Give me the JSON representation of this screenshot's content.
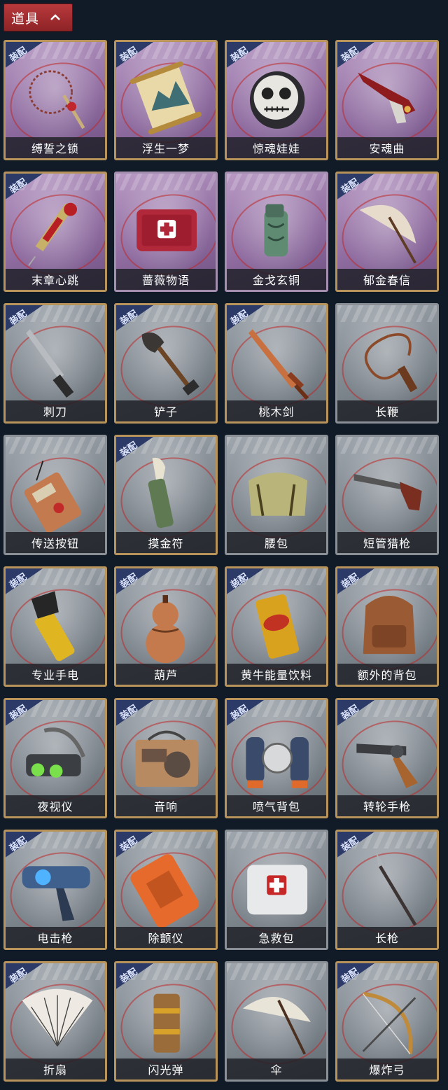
{
  "header": {
    "title": "道具"
  },
  "equip_badge": "装配",
  "items": [
    {
      "name": "缚誓之锁",
      "equipped": true,
      "bg": "purple",
      "icon": "chain-lock-icon"
    },
    {
      "name": "浮生一梦",
      "equipped": true,
      "bg": "purple",
      "icon": "scroll-icon"
    },
    {
      "name": "惊魂娃娃",
      "equipped": true,
      "bg": "purple",
      "icon": "skull-doll-icon"
    },
    {
      "name": "安魂曲",
      "equipped": true,
      "bg": "purple",
      "icon": "ornate-gun-icon"
    },
    {
      "name": "末章心跳",
      "equipped": true,
      "bg": "purple",
      "icon": "syringe-icon"
    },
    {
      "name": "蔷薇物语",
      "equipped": false,
      "bg": "purple",
      "icon": "medical-kit-icon"
    },
    {
      "name": "金戈玄铜",
      "equipped": false,
      "bg": "purple",
      "icon": "bronze-grenade-icon"
    },
    {
      "name": "郁金春信",
      "equipped": true,
      "bg": "purple",
      "icon": "umbrella-icon"
    },
    {
      "name": "刺刀",
      "equipped": true,
      "bg": "gray",
      "icon": "bayonet-icon"
    },
    {
      "name": "铲子",
      "equipped": true,
      "bg": "gray",
      "icon": "shovel-icon"
    },
    {
      "name": "桃木剑",
      "equipped": true,
      "bg": "gray",
      "icon": "wooden-sword-icon"
    },
    {
      "name": "长鞭",
      "equipped": false,
      "bg": "gray",
      "icon": "whip-icon"
    },
    {
      "name": "传送按钮",
      "equipped": false,
      "bg": "gray",
      "icon": "teleport-button-icon"
    },
    {
      "name": "摸金符",
      "equipped": true,
      "bg": "gray",
      "icon": "talisman-icon"
    },
    {
      "name": "腰包",
      "equipped": false,
      "bg": "gray",
      "icon": "waist-bag-icon"
    },
    {
      "name": "短管猎枪",
      "equipped": false,
      "bg": "gray",
      "icon": "shotgun-icon"
    },
    {
      "name": "专业手电",
      "equipped": true,
      "bg": "gray",
      "icon": "flashlight-icon"
    },
    {
      "name": "葫芦",
      "equipped": true,
      "bg": "gray",
      "icon": "gourd-icon"
    },
    {
      "name": "黄牛能量饮料",
      "equipped": true,
      "bg": "gray",
      "icon": "energy-drink-icon"
    },
    {
      "name": "额外的背包",
      "equipped": true,
      "bg": "gray",
      "icon": "backpack-icon"
    },
    {
      "name": "夜视仪",
      "equipped": true,
      "bg": "gray",
      "icon": "night-vision-icon"
    },
    {
      "name": "音响",
      "equipped": true,
      "bg": "gray",
      "icon": "radio-icon"
    },
    {
      "name": "喷气背包",
      "equipped": true,
      "bg": "gray",
      "icon": "jetpack-icon"
    },
    {
      "name": "转轮手枪",
      "equipped": true,
      "bg": "gray",
      "icon": "revolver-icon"
    },
    {
      "name": "电击枪",
      "equipped": true,
      "bg": "gray",
      "icon": "stun-gun-icon"
    },
    {
      "name": "除颤仪",
      "equipped": true,
      "bg": "gray",
      "icon": "defibrillator-icon"
    },
    {
      "name": "急救包",
      "equipped": false,
      "bg": "gray",
      "icon": "first-aid-icon"
    },
    {
      "name": "长枪",
      "equipped": true,
      "bg": "gray",
      "icon": "spear-icon"
    },
    {
      "name": "折扇",
      "equipped": true,
      "bg": "gray",
      "icon": "folding-fan-icon"
    },
    {
      "name": "闪光弹",
      "equipped": true,
      "bg": "gray",
      "icon": "flashbang-icon"
    },
    {
      "name": "伞",
      "equipped": false,
      "bg": "gray",
      "icon": "paper-umbrella-icon"
    },
    {
      "name": "爆炸弓",
      "equipped": true,
      "bg": "gray",
      "icon": "bow-icon"
    }
  ]
}
